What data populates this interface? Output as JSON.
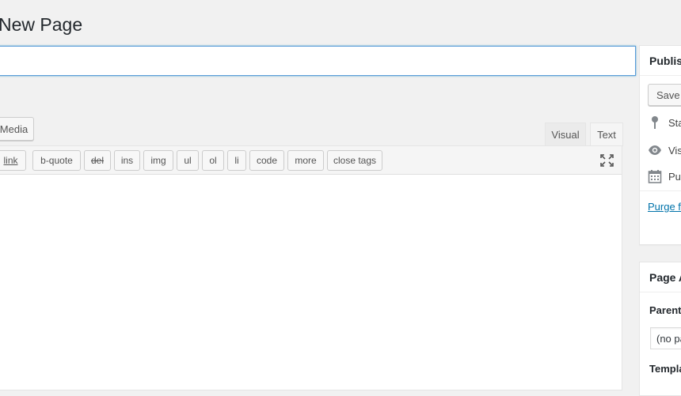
{
  "page": {
    "title": "New Page"
  },
  "title_field": {
    "value": ""
  },
  "editor": {
    "add_media_label": "Media",
    "tabs": {
      "visual": "Visual",
      "text": "Text"
    },
    "quicktags": [
      "link",
      "b-quote",
      "del",
      "ins",
      "img",
      "ul",
      "ol",
      "li",
      "code",
      "more",
      "close tags"
    ],
    "content": "",
    "fullscreen_icon": "distraction-free-icon"
  },
  "publish_box": {
    "title": "Publish",
    "save_label": "Save",
    "status_label": "Status:",
    "visibility_label": "Visibility:",
    "publish_label": "Publish",
    "purge_link": "Purge from cache",
    "icons": {
      "status": "pin-icon",
      "visibility": "eye-icon",
      "publish": "calendar-icon"
    }
  },
  "page_attributes": {
    "title": "Page Attributes",
    "parent_label": "Parent",
    "parent_selected": "(no parent)",
    "template_label": "Template"
  },
  "colors": {
    "accent": "#0073aa",
    "focus_border": "#5b9dd9",
    "background": "#f1f1f1"
  }
}
